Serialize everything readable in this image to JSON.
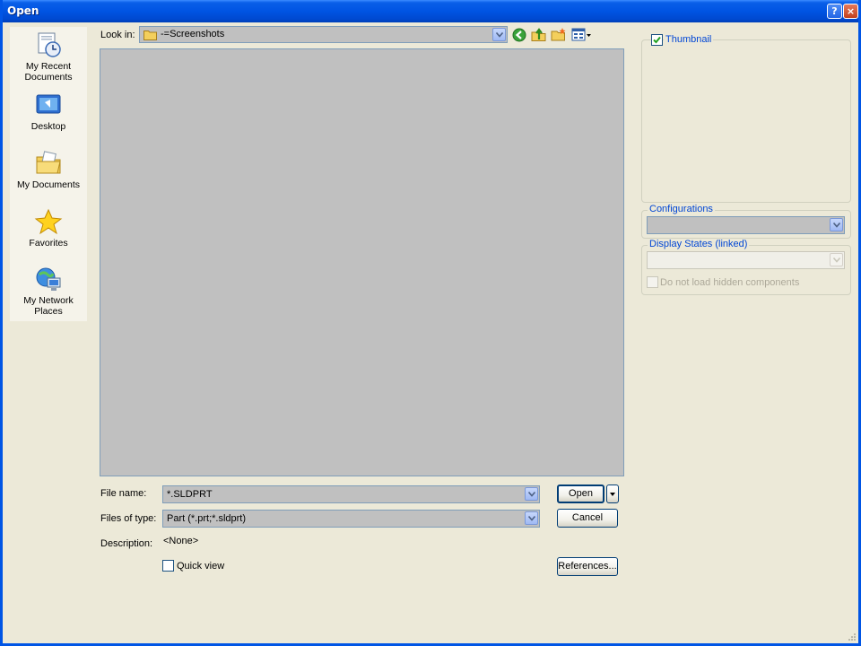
{
  "window": {
    "title": "Open",
    "help_glyph": "?",
    "close_glyph": "×"
  },
  "places": [
    {
      "label": "My Recent Documents",
      "icon": "recent-documents-icon"
    },
    {
      "label": "Desktop",
      "icon": "desktop-icon"
    },
    {
      "label": "My Documents",
      "icon": "my-documents-icon"
    },
    {
      "label": "Favorites",
      "icon": "favorites-icon"
    },
    {
      "label": "My Network Places",
      "icon": "network-places-icon"
    }
  ],
  "look_in": {
    "label": "Look in:",
    "value": "-=Screenshots"
  },
  "toolbar": {
    "back_icon": "back-icon",
    "up_icon": "up-folder-icon",
    "new_folder_icon": "new-folder-icon",
    "views_icon": "views-menu-icon"
  },
  "form": {
    "file_name_label": "File name:",
    "file_name_value": "*.SLDPRT",
    "files_of_type_label": "Files of type:",
    "files_of_type_value": "Part (*.prt;*.sldprt)",
    "description_label": "Description:",
    "description_value": "<None>",
    "quick_view_label": "Quick view",
    "quick_view_checked": false
  },
  "buttons": {
    "open": "Open",
    "cancel": "Cancel",
    "references": "References..."
  },
  "right_panel": {
    "thumbnail_label": "Thumbnail",
    "thumbnail_checked": true,
    "configurations_label": "Configurations",
    "display_states_label": "Display States (linked)",
    "hidden_components_label": "Do not load hidden components"
  },
  "colors": {
    "title_bar": "#0054e3",
    "dialog_bg": "#ece9d8",
    "group_title": "#0046d5",
    "disabled_text": "#aca899"
  }
}
